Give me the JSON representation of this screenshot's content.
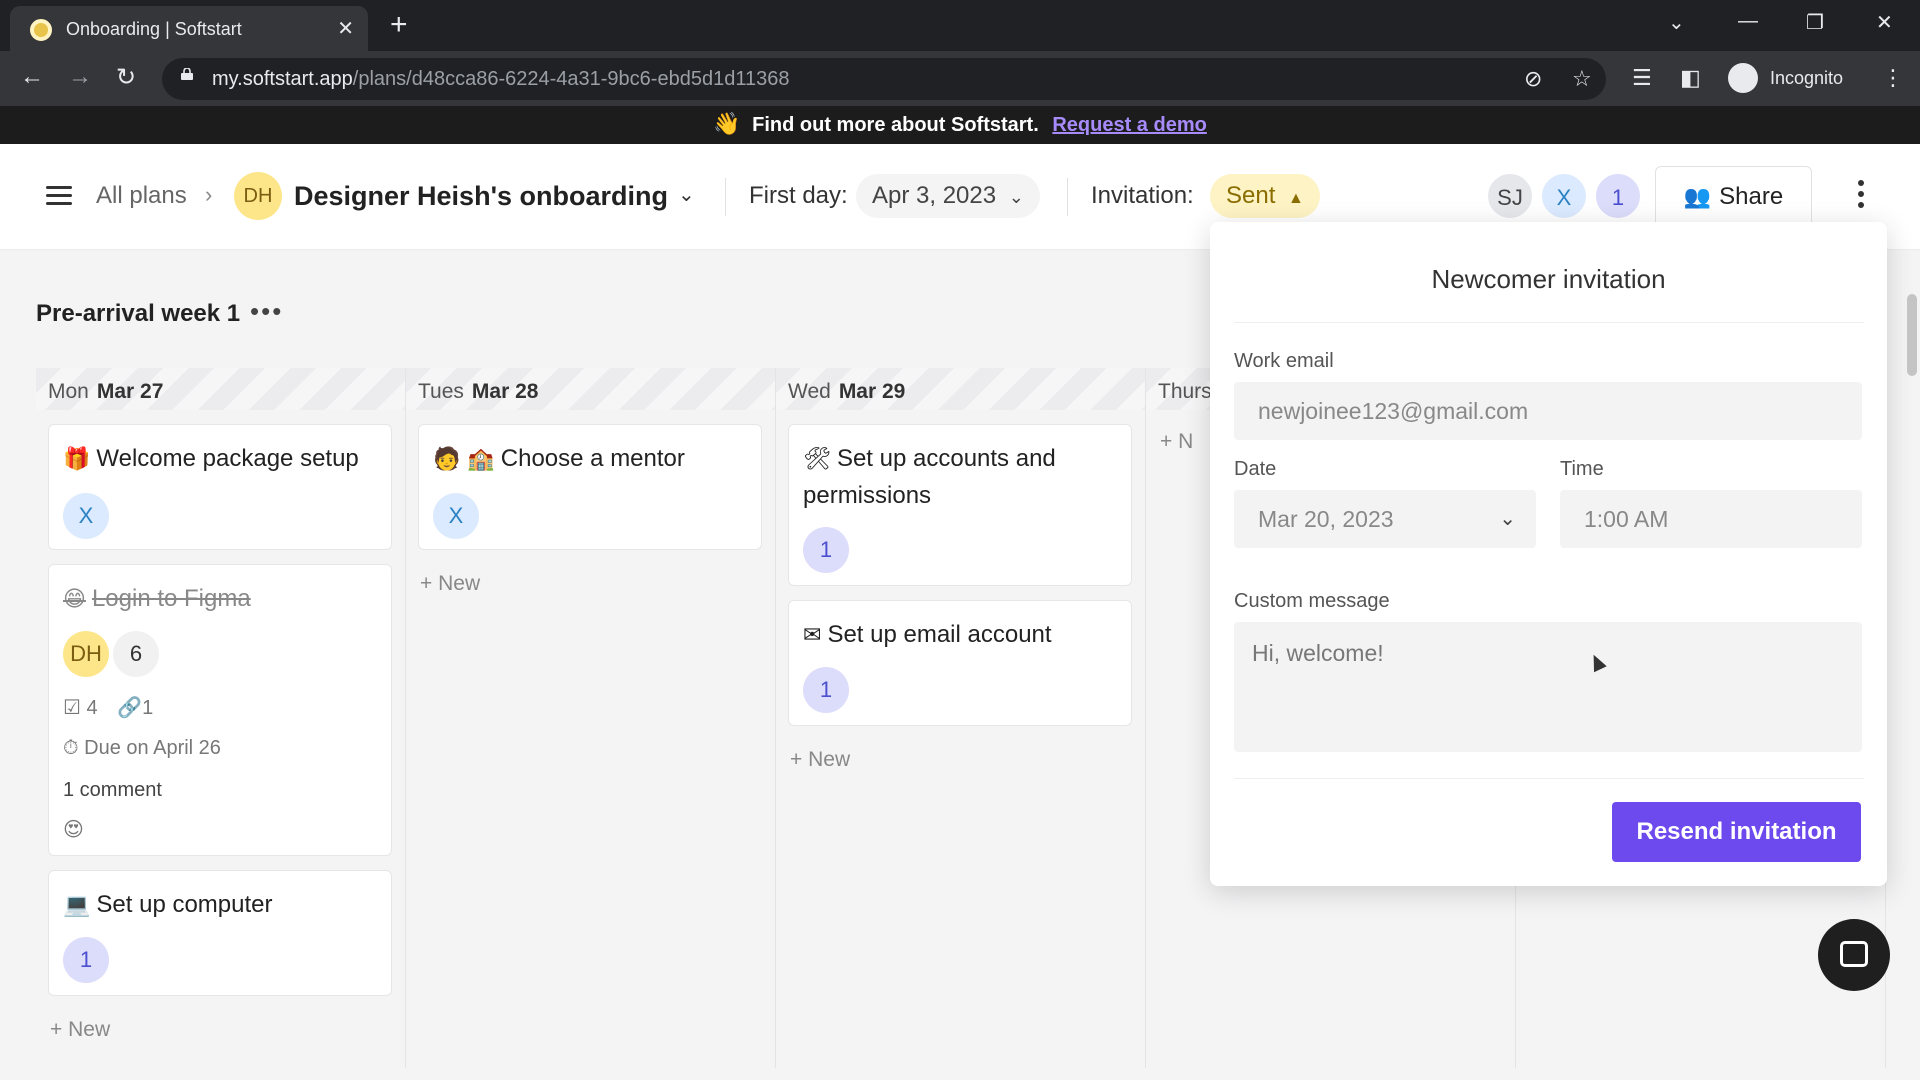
{
  "browser": {
    "tab_title": "Onboarding | Softstart",
    "url_host": "my.softstart.app",
    "url_path": "/plans/d48cca86-6224-4a31-9bc6-ebd5d1d11368",
    "profile_label": "Incognito"
  },
  "banner": {
    "emoji": "👋",
    "text": "Find out more about Softstart.",
    "link": "Request a demo"
  },
  "header": {
    "breadcrumb": "All plans",
    "plan_initials": "DH",
    "plan_title": "Designer Heish's onboarding",
    "first_day_label": "First day:",
    "first_day_value": "Apr 3, 2023",
    "invitation_label": "Invitation:",
    "invitation_status": "Sent",
    "avatars": [
      "SJ",
      "X",
      "1"
    ],
    "share_label": "Share"
  },
  "board": {
    "week_title": "Pre-arrival week 1",
    "new_label": "New",
    "columns": [
      {
        "day": "Mon",
        "date": "Mar 27"
      },
      {
        "day": "Tues",
        "date": "Mar 28"
      },
      {
        "day": "Wed",
        "date": "Mar 29"
      },
      {
        "day": "Thurs",
        "date": ""
      }
    ],
    "cards": {
      "welcome": {
        "emoji": "🎁",
        "title": "Welcome package setup",
        "assignee": "X"
      },
      "figma": {
        "emoji": "😄",
        "title": "Login to Figma",
        "assignee": "DH",
        "count": "6",
        "checklist": "4",
        "links": "1",
        "due": "Due on April 26",
        "comments": "1 comment",
        "reaction": "😍"
      },
      "computer": {
        "emoji": "💻",
        "title": "Set up computer",
        "assignee": "1"
      },
      "mentor": {
        "emoji": "🧑 🏫",
        "title": "Choose a mentor",
        "assignee": "X"
      },
      "accounts": {
        "emoji": "🛠",
        "title": "Set up accounts and permissions",
        "assignee": "1"
      },
      "email": {
        "emoji": "✉",
        "title": "Set up email account",
        "assignee": "1"
      }
    },
    "thurs_new_partial": "N"
  },
  "invitation": {
    "title": "Newcomer invitation",
    "email_label": "Work email",
    "email_value": "newjoinee123@gmail.com",
    "date_label": "Date",
    "date_value": "Mar 20, 2023",
    "time_label": "Time",
    "time_value": "1:00 AM",
    "message_label": "Custom message",
    "message_value": "Hi, welcome!",
    "resend_label": "Resend invitation"
  }
}
